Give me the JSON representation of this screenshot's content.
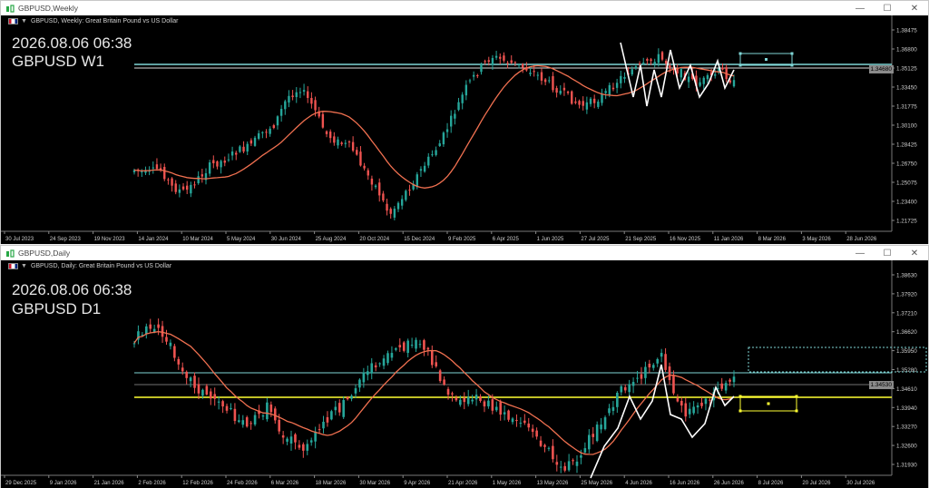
{
  "weekly": {
    "window_title": "GBPUSD,Weekly",
    "info_line": "GBPUSD, Weekly:  Great Britain Pound vs US Dollar",
    "overlay_time": "2026.08.06 06:38",
    "overlay_symbol": "GBPUSD W1",
    "current_price_label": "1.34680",
    "price_ticks": [
      "1.38475",
      "1.36800",
      "1.35125",
      "1.33450",
      "1.31775",
      "1.30100",
      "1.28425",
      "1.26750",
      "1.25075",
      "1.23400",
      "1.21725"
    ],
    "date_ticks": [
      "30 Jul 2023",
      "24 Sep 2023",
      "19 Nov 2023",
      "14 Jan 2024",
      "10 Mar 2024",
      "5 May 2024",
      "30 Jun 2024",
      "25 Aug 2024",
      "20 Oct 2024",
      "15 Dec 2024",
      "9 Feb 2025",
      "6 Apr 2025",
      "1 Jun 2025",
      "27 Jul 2025",
      "21 Sep 2025",
      "16 Nov 2025",
      "11 Jan 2026",
      "8 Mar 2026",
      "3 May 2026",
      "28 Jun 2026"
    ]
  },
  "daily": {
    "window_title": "GBPUSD,Daily",
    "info_line": "GBPUSD, Daily:  Great Britain Pound vs US Dollar",
    "overlay_time": "2026.08.06 06:38",
    "overlay_symbol": "GBPUSD D1",
    "current_price_label": "1.34530",
    "price_ticks": [
      "1.38630",
      "1.37920",
      "1.37210",
      "1.36620",
      "1.35950",
      "1.35280",
      "1.34610",
      "1.33940",
      "1.33270",
      "1.32600",
      "1.31930"
    ],
    "date_ticks": [
      "29 Dec 2025",
      "9 Jan 2026",
      "21 Jan 2026",
      "2 Feb 2026",
      "12 Feb 2026",
      "24 Feb 2026",
      "6 Mar 2026",
      "18 Mar 2026",
      "30 Mar 2026",
      "9 Apr 2026",
      "21 Apr 2026",
      "1 May 2026",
      "13 May 2026",
      "25 May 2026",
      "4 Jun 2026",
      "16 Jun 2026",
      "26 Jun 2026",
      "8 Jul 2026",
      "20 Jul 2026",
      "30 Jul 2026"
    ]
  },
  "colors": {
    "bull": "#26a69a",
    "bear": "#ef5350",
    "ma": "#f07050",
    "zigzag": "#ffffff",
    "hline": "#7fd6d6",
    "yellow": "#ffff33"
  },
  "icons": {
    "app": "mt-chart-icon",
    "minimize": "minimize-icon",
    "maximize": "maximize-icon",
    "close": "close-icon"
  }
}
